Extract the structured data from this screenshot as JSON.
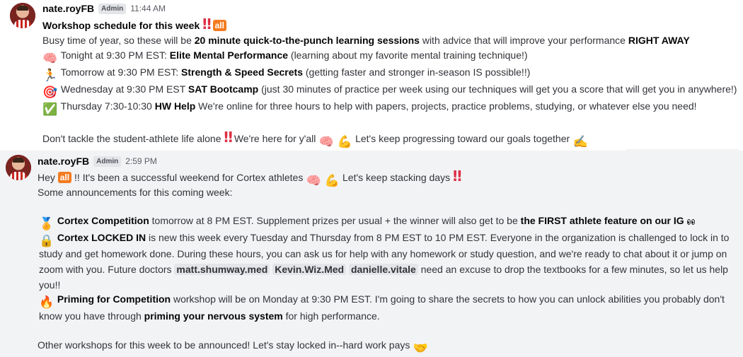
{
  "messages": [
    {
      "username": "nate.royFB",
      "badge": "Admin",
      "timestamp": "11:44 AM",
      "title": "Workshop schedule for this week",
      "all_label": "all",
      "intro": {
        "pre": "Busy time of year, so these will be ",
        "bold1": "20 minute quick-to-the-punch learning sessions",
        "mid": " with advice that will improve your performance ",
        "bold2": "RIGHT AWAY"
      },
      "schedule": [
        {
          "icon": "brain-icon",
          "glyph": "🧠",
          "pre": "Tonight at 9:30 PM EST: ",
          "bold": "Elite Mental Performance",
          "post": " (learning about my favorite mental training technique!)"
        },
        {
          "icon": "runner-icon",
          "glyph": "🏃",
          "pre": "Tomorrow at 9:30 PM EST: ",
          "bold": "Strength & Speed Secrets",
          "post": " (getting faster and stronger in-season IS possible!!)"
        },
        {
          "icon": "target-icon",
          "glyph": "🎯",
          "pre": "Wednesday at 9:30 PM EST ",
          "bold": "SAT Bootcamp",
          "post": " (just 30 minutes of practice per week using our techniques will get you a score that will get you in anywhere!)"
        },
        {
          "icon": "check-mark-icon",
          "glyph": "✅",
          "pre": "Thursday 7:30-10:30 ",
          "bold": "HW Help",
          "post": " We're online for three hours to help with papers, projects, practice problems, studying, or whatever else you need!"
        }
      ],
      "closing": {
        "part1": "Don't tackle the student-athlete life alone ",
        "part2": " We're here for y'all ",
        "part3": " Let's keep progressing toward our goals together "
      }
    },
    {
      "username": "nate.royFB",
      "badge": "Admin",
      "timestamp": "2:59 PM",
      "greeting": {
        "hey": "Hey ",
        "all_label": "all",
        "rest": " !! It's been a successful weekend for Cortex athletes ",
        "stack": " Let's keep stacking days "
      },
      "announce_intro": "Some announcements for this coming week:",
      "competition": {
        "bold": "Cortex Competition",
        "text": " tomorrow at 8 PM EST. Supplement prizes per usual + the winner will also get to be ",
        "bold2": "the FIRST athlete feature on our IG"
      },
      "locked_in": {
        "bold": "Cortex LOCKED IN",
        "line1": " is new this week every Tuesday and Thursday from 8 PM EST to 10 PM EST. Everyone in the organization is challenged to lock in to",
        "line2": "study and get homework done. During these hours, you can ask us for help with any homework or study question, and we're ready to chat about it or jump on",
        "line3_pre": "zoom with you. Future doctors ",
        "mentions": [
          "matt.shumway.med",
          "Kevin.Wiz.Med",
          "danielle.vitale"
        ],
        "line3_post": " need an excuse to drop the textbooks for a few minutes, so let us help",
        "line4": "you!!"
      },
      "priming": {
        "bold": "Priming for Competition",
        "line1": " workshop will be on Monday at 9:30 PM EST. I'm going to share the secrets to how you can unlock abilities you probably don't",
        "line2_pre": "know you have through ",
        "line2_bold": "priming your nervous system",
        "line2_post": " for high performance."
      },
      "footer": "Other workshops for this week to be announced! Let's stay locked in--hard work pays "
    }
  ]
}
